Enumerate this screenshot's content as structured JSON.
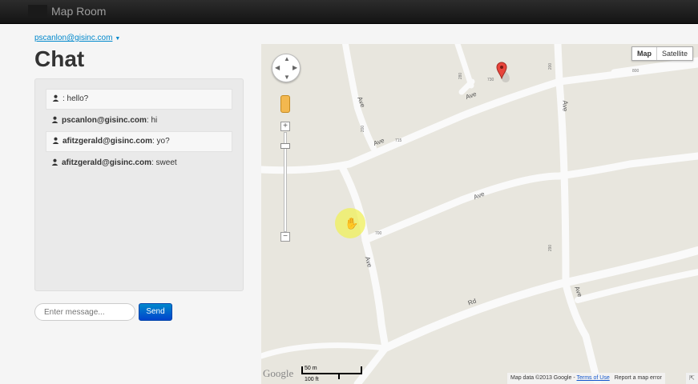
{
  "app": {
    "title": "Map Room"
  },
  "user": {
    "email": "pscanlon@gisinc.com"
  },
  "chat": {
    "title": "Chat",
    "messages": [
      {
        "sender": "",
        "text": ": hello?"
      },
      {
        "sender": "pscanlon@gisinc.com",
        "text": ": hi"
      },
      {
        "sender": "afitzgerald@gisinc.com",
        "text": ": yo?"
      },
      {
        "sender": "afitzgerald@gisinc.com",
        "text": ": sweet"
      }
    ],
    "input_placeholder": "Enter message...",
    "send_label": "Send"
  },
  "map": {
    "type_buttons": {
      "map": "Map",
      "satellite": "Satellite"
    },
    "zoom_in": "+",
    "zoom_out": "−",
    "street_labels": [
      "Ave",
      "Ave",
      "Ave",
      "Ave",
      "Ave",
      "Rd",
      "Ave",
      "Ave"
    ],
    "house_numbers": [
      "730",
      "280",
      "200",
      "800",
      "715",
      "700",
      "200",
      "290"
    ],
    "google_logo": "Google",
    "scale": {
      "metric": "50 m",
      "imperial": "100 ft"
    },
    "attribution": {
      "data": "Map data ©2013 Google",
      "sep": " - ",
      "terms": "Terms of Use",
      "report": "Report a map error"
    }
  },
  "colors": {
    "navbar": "#1b1b1b",
    "accent": "#0088cc",
    "marker": "#e8453c",
    "road": "#ffffff",
    "map_bg": "#e8e6de"
  }
}
